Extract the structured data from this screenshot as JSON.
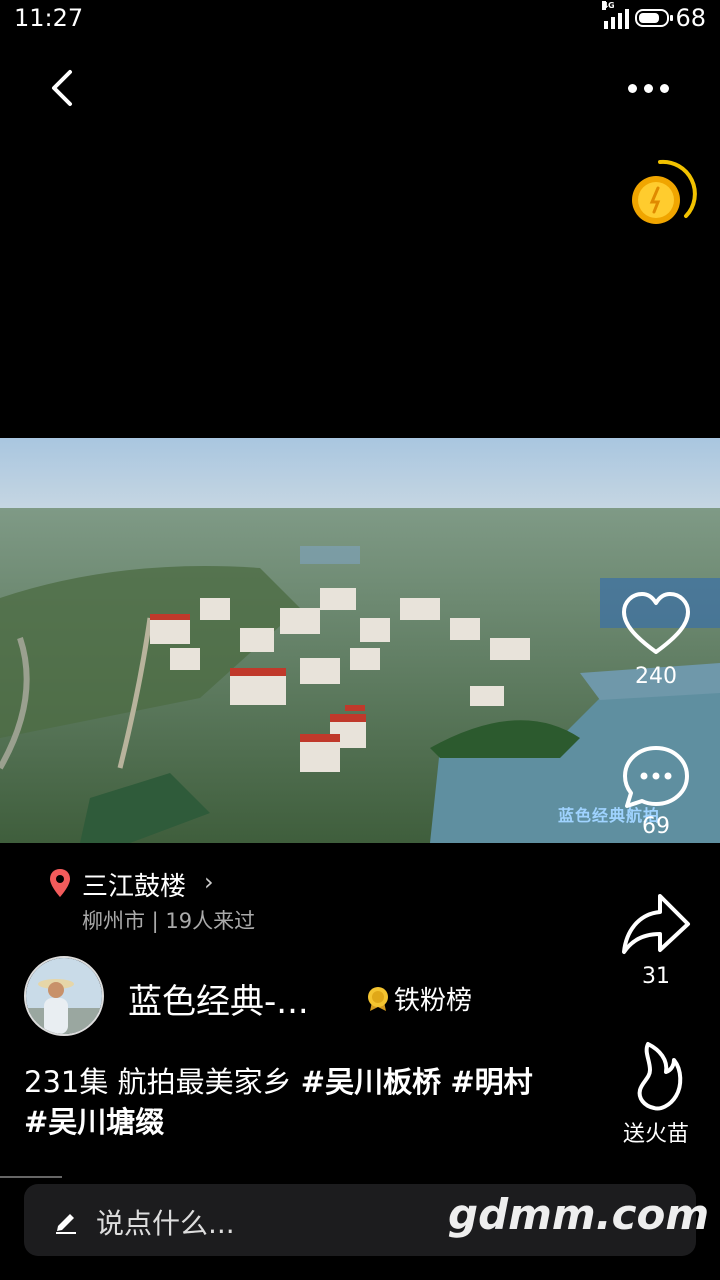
{
  "status_bar": {
    "time": "11:27",
    "network": "4G",
    "battery": "68"
  },
  "top_bar": {
    "back_icon": "chevron-left-icon",
    "more_icon": "more-horizontal-icon"
  },
  "video": {
    "watermark": "蓝色经典航拍"
  },
  "actions": {
    "like_count": "240",
    "comment_count": "69",
    "share_count": "31",
    "gift_label": "送火苗"
  },
  "location": {
    "name": "三江鼓楼",
    "sub": "柳州市 | 19人来过"
  },
  "author": {
    "name": "蓝色经典-...",
    "badge": "铁粉榜"
  },
  "caption": {
    "text": "231集 航拍最美家乡 ",
    "tags": [
      "#吴川板桥",
      "#明村",
      "#吴川塘缀"
    ]
  },
  "comment_input": {
    "placeholder": "说点什么...",
    "site_mark": "gdmm.com"
  }
}
